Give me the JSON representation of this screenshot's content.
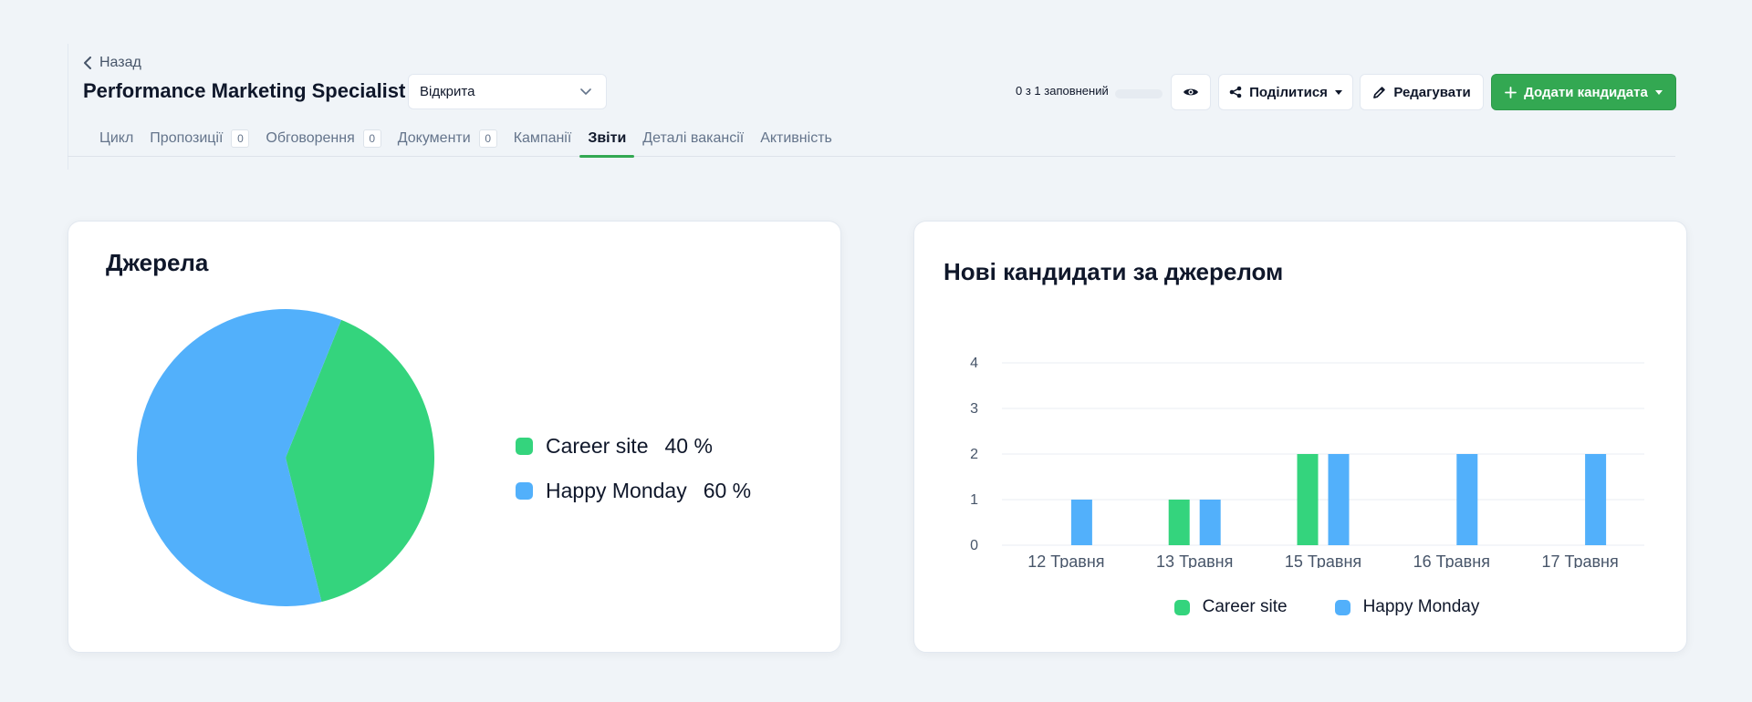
{
  "header": {
    "back_label": "Назад",
    "title": "Performance Marketing Specialist",
    "status": "Відкрита",
    "progress_text": "0 з 1 заповнений",
    "progress_fraction": 0,
    "share_label": "Поділитися",
    "edit_label": "Редагувати",
    "add_label": "Додати кандидата"
  },
  "tabs": [
    {
      "label": "Цикл",
      "badge": null,
      "active": false
    },
    {
      "label": "Пропозиції",
      "badge": "0",
      "active": false
    },
    {
      "label": "Обговорення",
      "badge": "0",
      "active": false
    },
    {
      "label": "Документи",
      "badge": "0",
      "active": false
    },
    {
      "label": "Кампанії",
      "badge": null,
      "active": false
    },
    {
      "label": "Звіти",
      "badge": null,
      "active": true
    },
    {
      "label": "Деталі вакансії",
      "badge": null,
      "active": false
    },
    {
      "label": "Активність",
      "badge": null,
      "active": false
    }
  ],
  "colors": {
    "accent": "#33a852",
    "career_site": "#34d47d",
    "happy_monday": "#52b0fb"
  },
  "icons": {
    "back": "chevron-left-icon",
    "status": "chevron-down-icon",
    "preview": "eye-icon",
    "share": "share-icon",
    "edit": "pencil-icon",
    "add": "plus-icon"
  },
  "chart_data": [
    {
      "type": "pie",
      "title": "Джерела",
      "slices": [
        {
          "label": "Career site",
          "value": 40,
          "value_label": "40 %",
          "color": "#34d47d"
        },
        {
          "label": "Happy Monday",
          "value": 60,
          "value_label": "60 %",
          "color": "#52b0fb"
        }
      ],
      "legend_position": "right"
    },
    {
      "type": "bar",
      "title": "Нові кандидати за джерелом",
      "categories": [
        "12 Травня",
        "13 Травня",
        "15 Травня",
        "16 Травня",
        "17 Травня"
      ],
      "series": [
        {
          "name": "Career site",
          "values": [
            0,
            1,
            2,
            0,
            0
          ],
          "color": "#34d47d"
        },
        {
          "name": "Happy Monday",
          "values": [
            1,
            1,
            2,
            2,
            2
          ],
          "color": "#52b0fb"
        }
      ],
      "ylim": [
        0,
        4
      ],
      "yticks": [
        0,
        1,
        2,
        3,
        4
      ],
      "grid": true,
      "legend_position": "bottom"
    }
  ]
}
